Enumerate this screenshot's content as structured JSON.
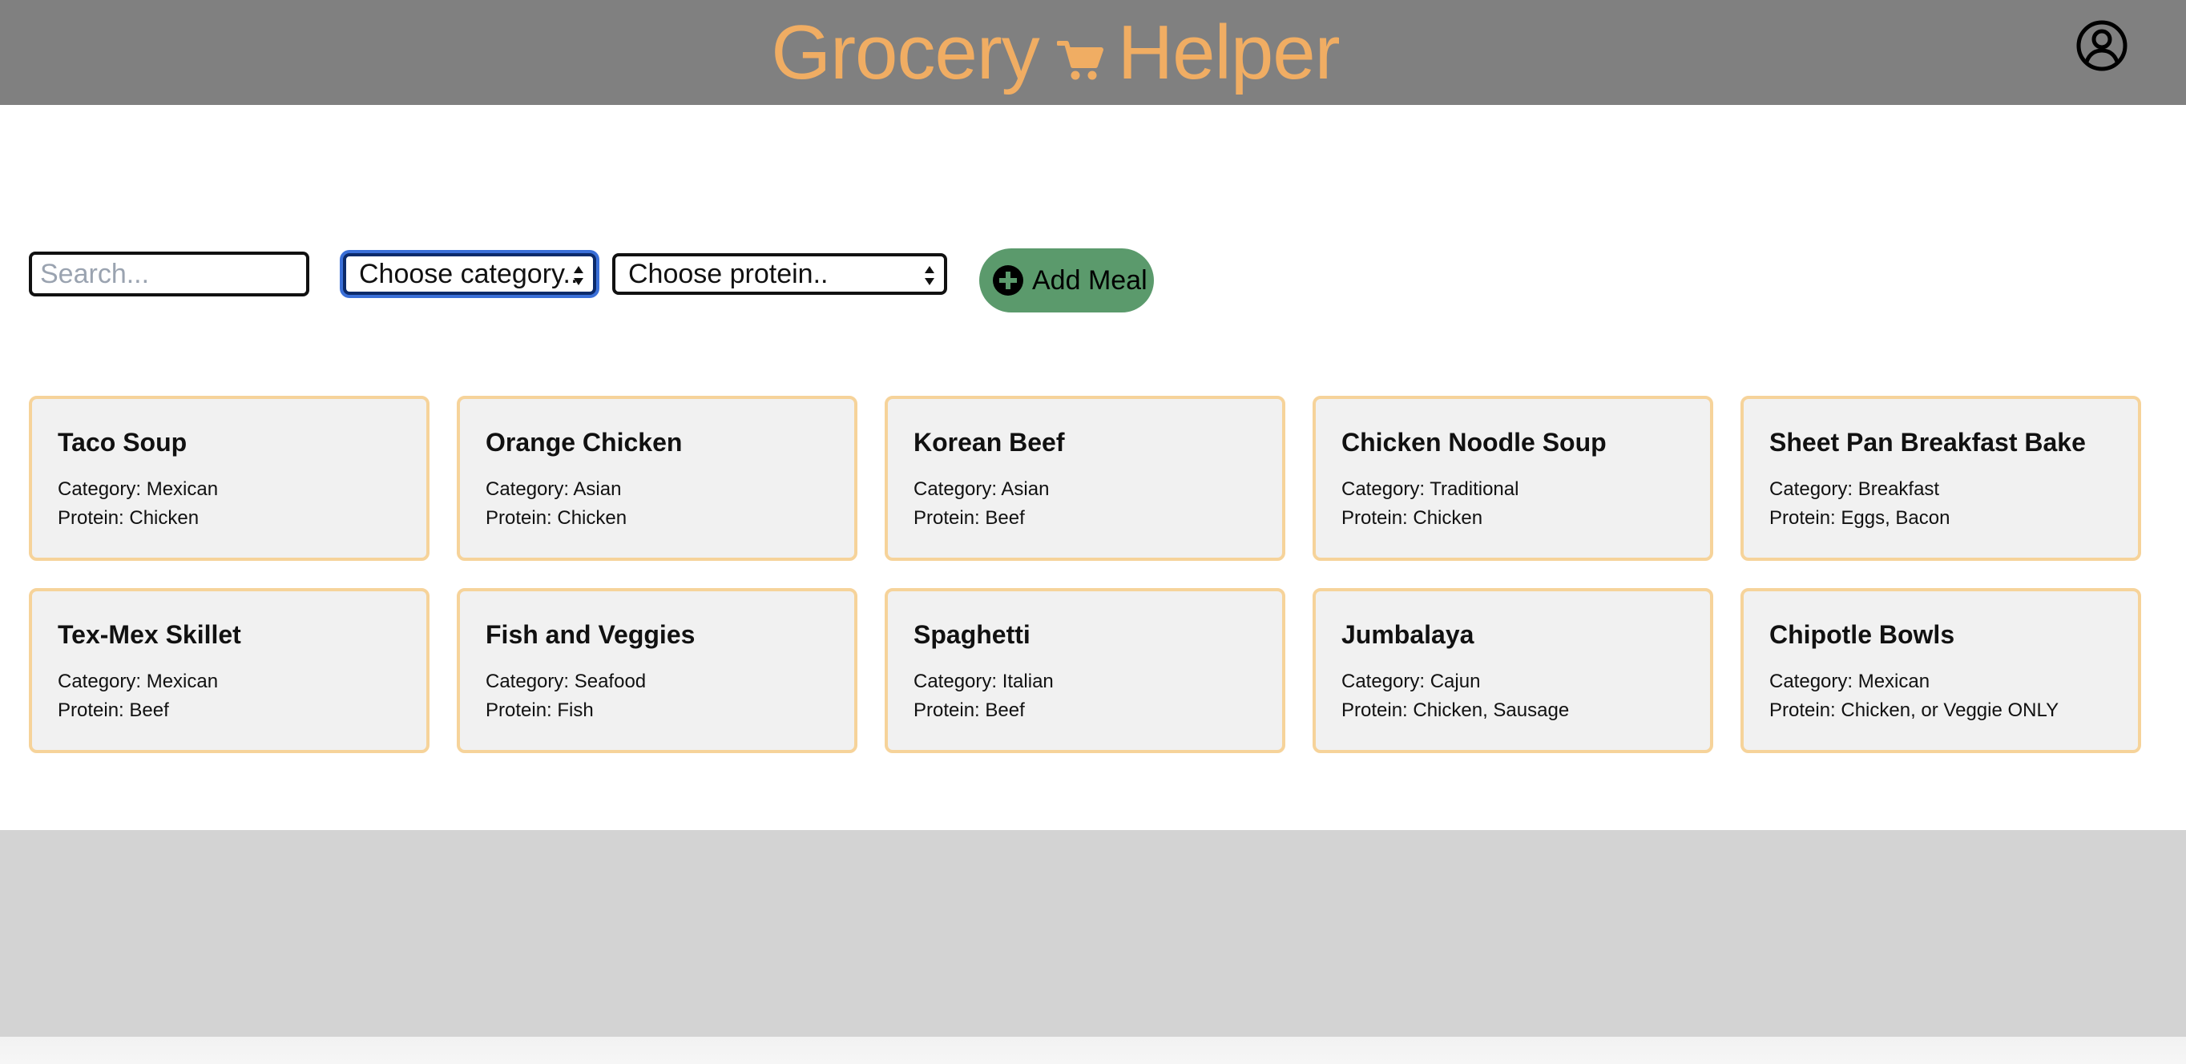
{
  "app": {
    "title_left": "Grocery",
    "title_right": "Helper",
    "logo_icon": "cart-icon",
    "account_icon": "user-circle-icon",
    "title_color": "#f0ad63",
    "header_color": "#808080"
  },
  "filters": {
    "search_placeholder": "Search...",
    "search_value": "",
    "category_selected": "Choose category..",
    "protein_selected": "Choose protein..",
    "add_button_label": "Add Meal",
    "add_button_color": "#5b9a6c"
  },
  "labels": {
    "category_prefix": "Category: ",
    "protein_prefix": "Protein: "
  },
  "meals": [
    {
      "name": "Taco Soup",
      "category": "Category: Mexican",
      "protein": "Protein: Chicken"
    },
    {
      "name": "Orange Chicken",
      "category": "Category: Asian",
      "protein": "Protein: Chicken"
    },
    {
      "name": "Korean Beef",
      "category": "Category: Asian",
      "protein": "Protein: Beef"
    },
    {
      "name": "Chicken Noodle Soup",
      "category": "Category: Traditional",
      "protein": "Protein: Chicken"
    },
    {
      "name": "Sheet Pan Breakfast Bake",
      "category": "Category: Breakfast",
      "protein": "Protein: Eggs, Bacon"
    },
    {
      "name": "Tex-Mex Skillet",
      "category": "Category: Mexican",
      "protein": "Protein: Beef"
    },
    {
      "name": "Fish and Veggies",
      "category": "Category: Seafood",
      "protein": "Protein: Fish"
    },
    {
      "name": "Spaghetti",
      "category": "Category: Italian",
      "protein": "Protein: Beef"
    },
    {
      "name": "Jumbalaya",
      "category": "Category: Cajun",
      "protein": "Protein: Chicken, Sausage"
    },
    {
      "name": "Chipotle Bowls",
      "category": "Category: Mexican",
      "protein": "Protein: Chicken, or Veggie ONLY"
    }
  ]
}
